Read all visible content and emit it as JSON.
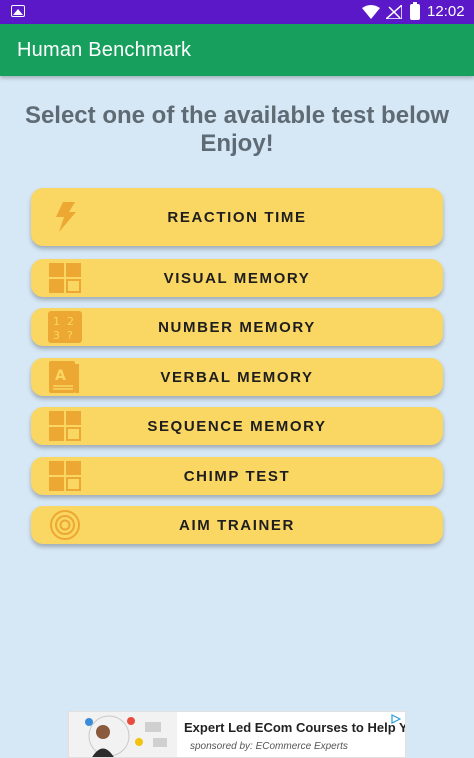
{
  "status_bar": {
    "time": "12:02",
    "icons": [
      "gallery-icon",
      "wifi-icon",
      "no-signal-icon",
      "battery-icon"
    ]
  },
  "app_bar": {
    "title": "Human Benchmark"
  },
  "headline": "Select one of the available test below Enjoy!",
  "tests": [
    {
      "label": "REACTION TIME",
      "icon": "lightning-icon"
    },
    {
      "label": "VISUAL MEMORY",
      "icon": "grid-icon"
    },
    {
      "label": "NUMBER MEMORY",
      "icon": "numbers-icon"
    },
    {
      "label": "VERBAL MEMORY",
      "icon": "book-icon"
    },
    {
      "label": "SEQUENCE MEMORY",
      "icon": "grid-icon"
    },
    {
      "label": "CHIMP TEST",
      "icon": "grid-icon"
    },
    {
      "label": "AIM TRAINER",
      "icon": "target-icon"
    }
  ],
  "ad": {
    "headline": "Expert Led ECom Courses to Help Yo...",
    "sponsor": "sponsored by: ECommerce Experts"
  },
  "colors": {
    "status_bar": "#5b18c9",
    "app_bar": "#17a05d",
    "background": "#d6e7f5",
    "button": "#fad662",
    "icon": "#eda833",
    "headline": "#5f6b74"
  }
}
